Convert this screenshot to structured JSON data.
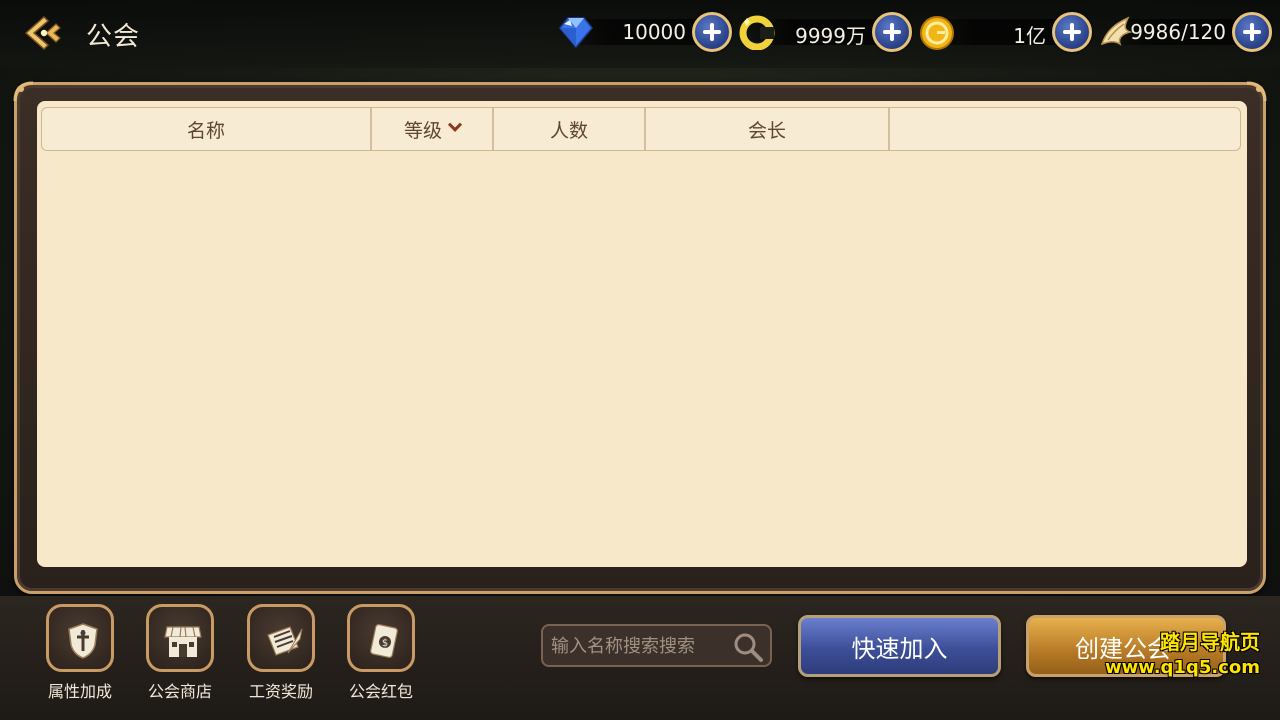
{
  "header": {
    "title": "公会"
  },
  "currencies": [
    {
      "name": "diamond",
      "icon": "diamond-icon",
      "value": "10000"
    },
    {
      "name": "coupon",
      "icon": "c-coin-icon",
      "value": "9999万"
    },
    {
      "name": "gold",
      "icon": "gold-coin-icon",
      "value": "1亿"
    },
    {
      "name": "stamina",
      "icon": "wing-icon",
      "value": "9986/120"
    }
  ],
  "table": {
    "columns": [
      "名称",
      "等级",
      "人数",
      "会长",
      ""
    ]
  },
  "functions": [
    {
      "label": "属性加成",
      "icon": "shield-sword-icon"
    },
    {
      "label": "公会商店",
      "icon": "shop-icon"
    },
    {
      "label": "工资奖励",
      "icon": "scroll-quill-icon"
    },
    {
      "label": "公会红包",
      "icon": "red-envelope-icon"
    }
  ],
  "search": {
    "placeholder": "输入名称搜索搜索"
  },
  "buttons": {
    "quick_join": "快速加入",
    "create_guild": "创建公会"
  },
  "watermark": {
    "line1": "踏月导航页",
    "line2": "www.q1q5.com"
  },
  "colors": {
    "panel_bg": "#f7e8ca",
    "frame_gold": "#c9a06a",
    "quick_btn": "#3d4f98",
    "create_btn": "#b77a25"
  }
}
